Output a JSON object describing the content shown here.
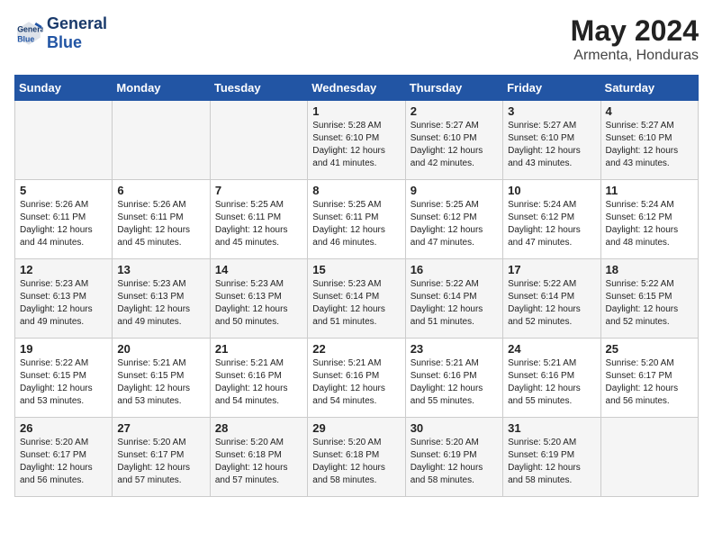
{
  "header": {
    "logo_line1": "General",
    "logo_line2": "Blue",
    "month_year": "May 2024",
    "location": "Armenta, Honduras"
  },
  "weekdays": [
    "Sunday",
    "Monday",
    "Tuesday",
    "Wednesday",
    "Thursday",
    "Friday",
    "Saturday"
  ],
  "weeks": [
    [
      {
        "day": "",
        "content": ""
      },
      {
        "day": "",
        "content": ""
      },
      {
        "day": "",
        "content": ""
      },
      {
        "day": "1",
        "content": "Sunrise: 5:28 AM\nSunset: 6:10 PM\nDaylight: 12 hours\nand 41 minutes."
      },
      {
        "day": "2",
        "content": "Sunrise: 5:27 AM\nSunset: 6:10 PM\nDaylight: 12 hours\nand 42 minutes."
      },
      {
        "day": "3",
        "content": "Sunrise: 5:27 AM\nSunset: 6:10 PM\nDaylight: 12 hours\nand 43 minutes."
      },
      {
        "day": "4",
        "content": "Sunrise: 5:27 AM\nSunset: 6:10 PM\nDaylight: 12 hours\nand 43 minutes."
      }
    ],
    [
      {
        "day": "5",
        "content": "Sunrise: 5:26 AM\nSunset: 6:11 PM\nDaylight: 12 hours\nand 44 minutes."
      },
      {
        "day": "6",
        "content": "Sunrise: 5:26 AM\nSunset: 6:11 PM\nDaylight: 12 hours\nand 45 minutes."
      },
      {
        "day": "7",
        "content": "Sunrise: 5:25 AM\nSunset: 6:11 PM\nDaylight: 12 hours\nand 45 minutes."
      },
      {
        "day": "8",
        "content": "Sunrise: 5:25 AM\nSunset: 6:11 PM\nDaylight: 12 hours\nand 46 minutes."
      },
      {
        "day": "9",
        "content": "Sunrise: 5:25 AM\nSunset: 6:12 PM\nDaylight: 12 hours\nand 47 minutes."
      },
      {
        "day": "10",
        "content": "Sunrise: 5:24 AM\nSunset: 6:12 PM\nDaylight: 12 hours\nand 47 minutes."
      },
      {
        "day": "11",
        "content": "Sunrise: 5:24 AM\nSunset: 6:12 PM\nDaylight: 12 hours\nand 48 minutes."
      }
    ],
    [
      {
        "day": "12",
        "content": "Sunrise: 5:23 AM\nSunset: 6:13 PM\nDaylight: 12 hours\nand 49 minutes."
      },
      {
        "day": "13",
        "content": "Sunrise: 5:23 AM\nSunset: 6:13 PM\nDaylight: 12 hours\nand 49 minutes."
      },
      {
        "day": "14",
        "content": "Sunrise: 5:23 AM\nSunset: 6:13 PM\nDaylight: 12 hours\nand 50 minutes."
      },
      {
        "day": "15",
        "content": "Sunrise: 5:23 AM\nSunset: 6:14 PM\nDaylight: 12 hours\nand 51 minutes."
      },
      {
        "day": "16",
        "content": "Sunrise: 5:22 AM\nSunset: 6:14 PM\nDaylight: 12 hours\nand 51 minutes."
      },
      {
        "day": "17",
        "content": "Sunrise: 5:22 AM\nSunset: 6:14 PM\nDaylight: 12 hours\nand 52 minutes."
      },
      {
        "day": "18",
        "content": "Sunrise: 5:22 AM\nSunset: 6:15 PM\nDaylight: 12 hours\nand 52 minutes."
      }
    ],
    [
      {
        "day": "19",
        "content": "Sunrise: 5:22 AM\nSunset: 6:15 PM\nDaylight: 12 hours\nand 53 minutes."
      },
      {
        "day": "20",
        "content": "Sunrise: 5:21 AM\nSunset: 6:15 PM\nDaylight: 12 hours\nand 53 minutes."
      },
      {
        "day": "21",
        "content": "Sunrise: 5:21 AM\nSunset: 6:16 PM\nDaylight: 12 hours\nand 54 minutes."
      },
      {
        "day": "22",
        "content": "Sunrise: 5:21 AM\nSunset: 6:16 PM\nDaylight: 12 hours\nand 54 minutes."
      },
      {
        "day": "23",
        "content": "Sunrise: 5:21 AM\nSunset: 6:16 PM\nDaylight: 12 hours\nand 55 minutes."
      },
      {
        "day": "24",
        "content": "Sunrise: 5:21 AM\nSunset: 6:16 PM\nDaylight: 12 hours\nand 55 minutes."
      },
      {
        "day": "25",
        "content": "Sunrise: 5:20 AM\nSunset: 6:17 PM\nDaylight: 12 hours\nand 56 minutes."
      }
    ],
    [
      {
        "day": "26",
        "content": "Sunrise: 5:20 AM\nSunset: 6:17 PM\nDaylight: 12 hours\nand 56 minutes."
      },
      {
        "day": "27",
        "content": "Sunrise: 5:20 AM\nSunset: 6:17 PM\nDaylight: 12 hours\nand 57 minutes."
      },
      {
        "day": "28",
        "content": "Sunrise: 5:20 AM\nSunset: 6:18 PM\nDaylight: 12 hours\nand 57 minutes."
      },
      {
        "day": "29",
        "content": "Sunrise: 5:20 AM\nSunset: 6:18 PM\nDaylight: 12 hours\nand 58 minutes."
      },
      {
        "day": "30",
        "content": "Sunrise: 5:20 AM\nSunset: 6:19 PM\nDaylight: 12 hours\nand 58 minutes."
      },
      {
        "day": "31",
        "content": "Sunrise: 5:20 AM\nSunset: 6:19 PM\nDaylight: 12 hours\nand 58 minutes."
      },
      {
        "day": "",
        "content": ""
      }
    ]
  ]
}
